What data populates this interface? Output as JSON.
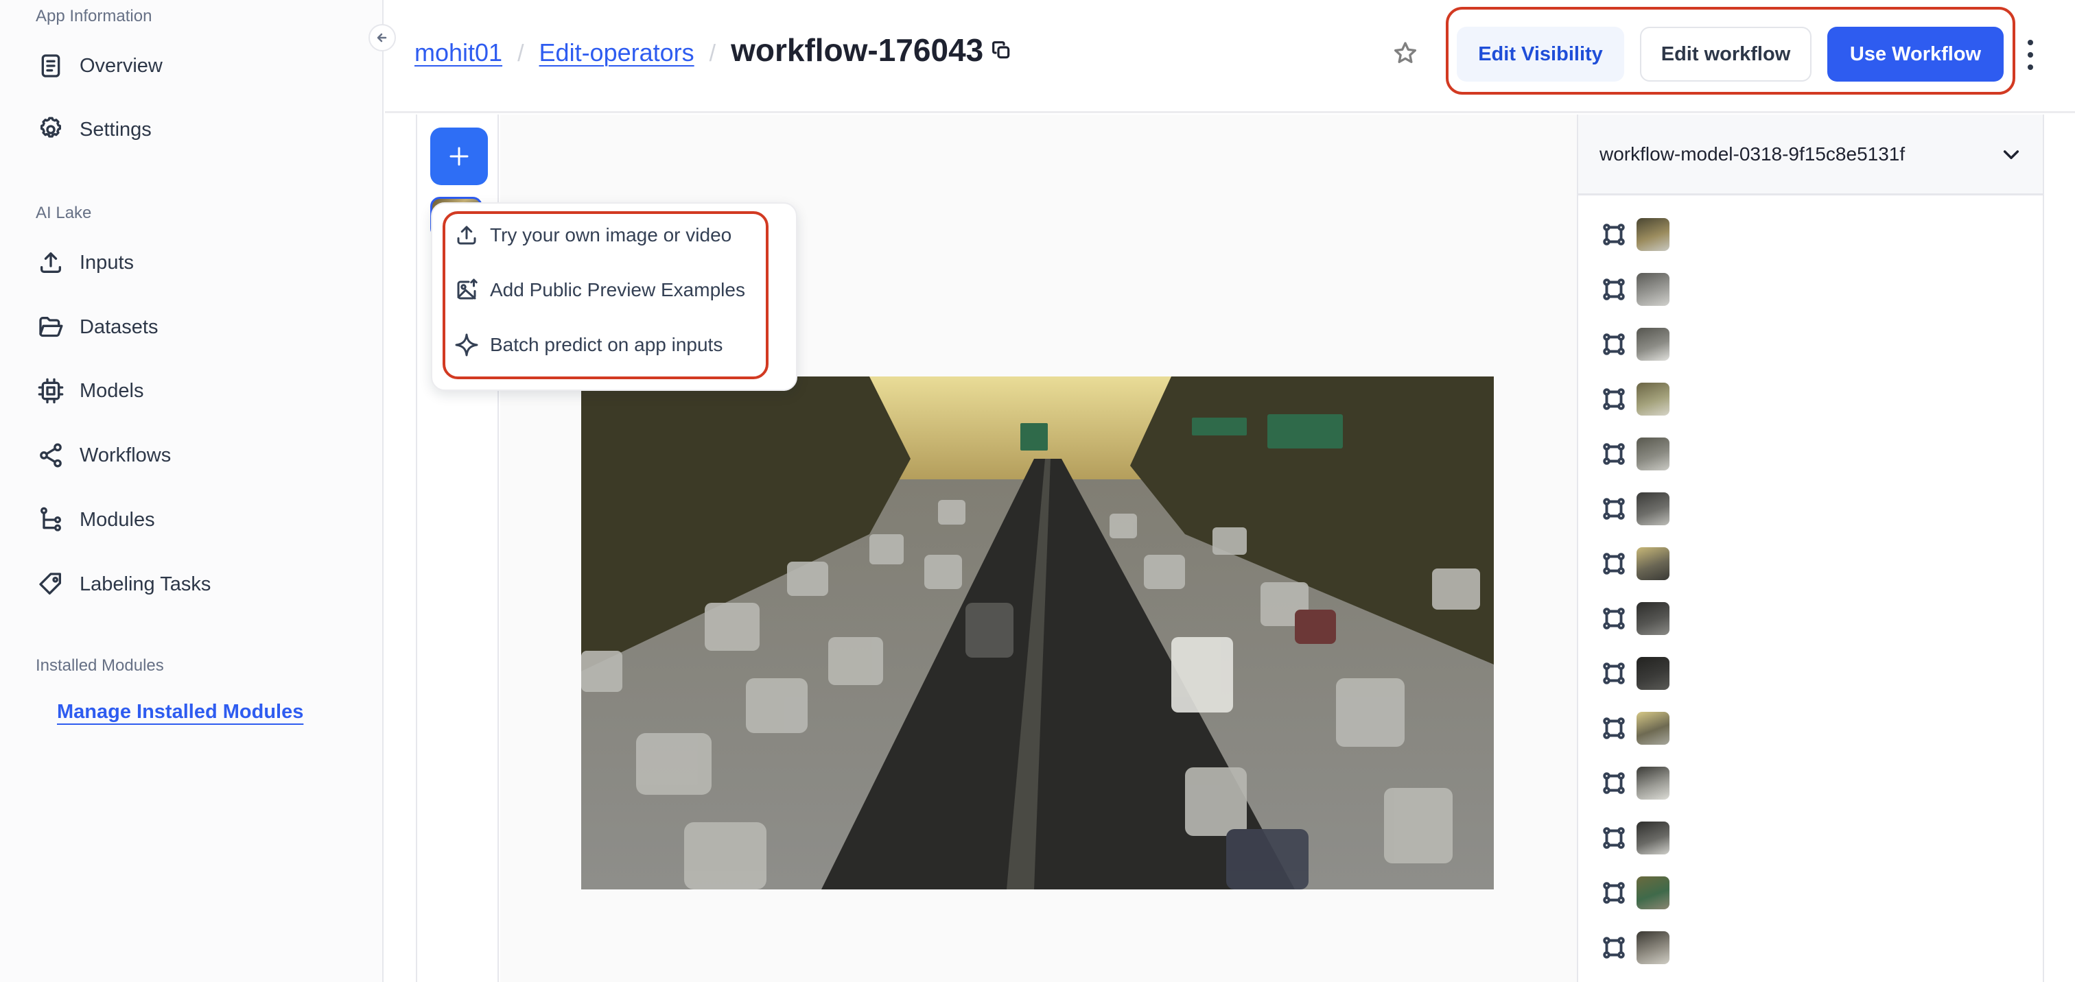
{
  "sidebar": {
    "collapse_icon": "arrow-left-icon",
    "sections": [
      {
        "title": "App Information",
        "items": [
          {
            "label": "Overview",
            "icon": "document-icon"
          },
          {
            "label": "Settings",
            "icon": "gear-icon"
          }
        ]
      },
      {
        "title": "AI Lake",
        "items": [
          {
            "label": "Inputs",
            "icon": "upload-icon"
          },
          {
            "label": "Datasets",
            "icon": "folder-open-icon"
          },
          {
            "label": "Models",
            "icon": "cpu-chip-icon"
          },
          {
            "label": "Workflows",
            "icon": "share-nodes-icon"
          },
          {
            "label": "Modules",
            "icon": "tree-branch-icon"
          },
          {
            "label": "Labeling Tasks",
            "icon": "tag-icon"
          }
        ]
      },
      {
        "title": "Installed Modules",
        "link": "Manage Installed Modules"
      }
    ]
  },
  "header": {
    "breadcrumb": [
      {
        "label": "mohit01",
        "link": true
      },
      {
        "label": "Edit-operators",
        "link": true
      },
      {
        "label": "workflow-176043",
        "link": false
      }
    ],
    "separator": "/",
    "copy_icon": "copy-icon",
    "star_icon": "star-icon",
    "buttons": {
      "edit_visibility": "Edit Visibility",
      "edit_workflow": "Edit workflow",
      "use_workflow": "Use Workflow"
    },
    "more_icon": "kebab-vertical-icon"
  },
  "toolbar": {
    "add_icon": "plus-icon"
  },
  "add_menu": {
    "items": [
      {
        "label": "Try your own image or video",
        "icon": "upload-icon"
      },
      {
        "label": "Add Public Preview Examples",
        "icon": "image-upload-icon"
      },
      {
        "label": "Batch predict on app inputs",
        "icon": "sparkle-icon"
      }
    ]
  },
  "preview": {
    "image_alt": "Highway traffic at sunset, La Brea Ave sign"
  },
  "right_panel": {
    "model_selector": "workflow-model-0318-9f15c8e5131f",
    "chevron_icon": "chevron-down-icon",
    "region_count": 14,
    "region_icon": "bounding-box-icon"
  },
  "colors": {
    "accent": "#2e5cf0",
    "highlight_annotation": "#d23a22",
    "text_primary": "#2d3748",
    "text_muted": "#667085"
  }
}
